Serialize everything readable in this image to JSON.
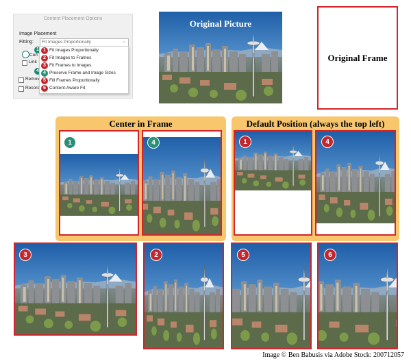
{
  "dialog": {
    "title": "Content Placement Options",
    "group_label": "Image Placement",
    "fitting_label": "Fitting:",
    "fitting_value": "Fit Images Proportionally",
    "menu_items": [
      {
        "num": "1",
        "label": "Fit Images Proportionally"
      },
      {
        "num": "2",
        "label": "Fit Images to Frames"
      },
      {
        "num": "3",
        "label": "Fit Frames to Images"
      },
      {
        "num": "4",
        "label": "Preserve Frame and Image Sizes"
      },
      {
        "num": "5",
        "label": "Fill Frames Proportionally"
      },
      {
        "num": "6",
        "label": "Content-Aware Fit"
      }
    ],
    "left_badges": [
      "1",
      "4"
    ],
    "option_labels": [
      "Cen",
      "Link",
      "Remov",
      "Record"
    ]
  },
  "original_picture_label": "Original Picture",
  "original_frame_label": "Original Frame",
  "center_panel": {
    "title": "Center in Frame",
    "badges": [
      "1",
      "4"
    ]
  },
  "default_panel": {
    "title": "Default Position (always the top left)",
    "badges": [
      "1",
      "4"
    ]
  },
  "bottom_badges": [
    "3",
    "2",
    "5",
    "6"
  ],
  "credit": "Image © Ben Babusis via Adobe Stock: 200712057",
  "colors": {
    "frame_red": "#d2242a",
    "panel_orange": "#f7c66d",
    "badge_red": "#c4262e",
    "badge_green": "#2a8f77"
  }
}
